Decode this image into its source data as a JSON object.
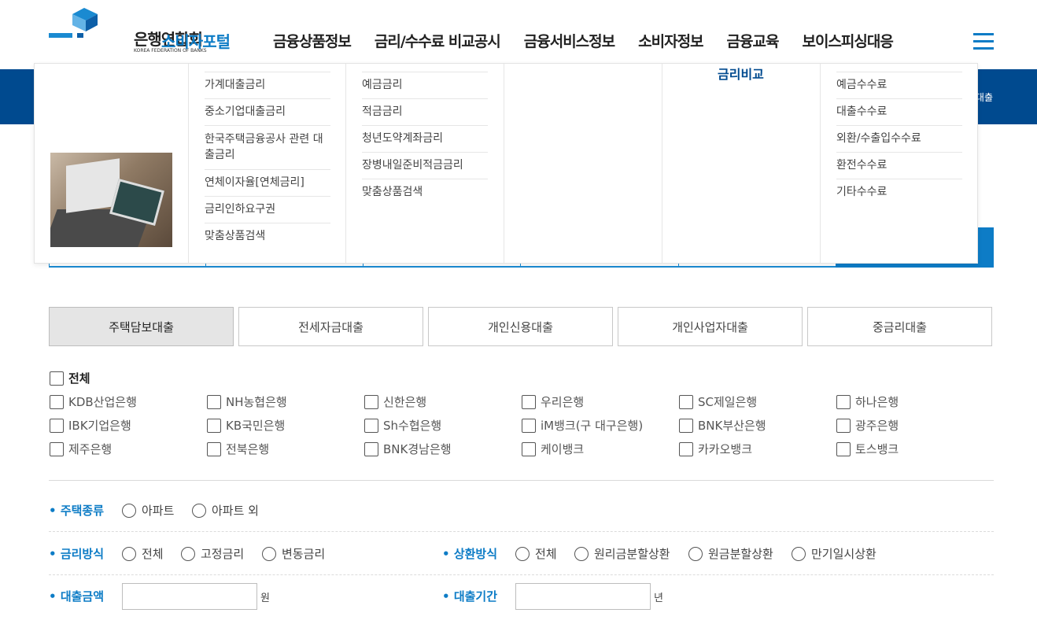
{
  "header": {
    "logo_text": "은행연합회",
    "logo_sub": "KOREA FEDERATION OF BANKS",
    "portal": "소비자포털",
    "nav": [
      "금융상품정보",
      "금리/수수료 비교공시",
      "금융서비스정보",
      "소비자정보",
      "금융교육",
      "보이스피싱대응"
    ]
  },
  "blue_band_text": "대출",
  "mega_menu": {
    "col1": [
      "가계대출금리",
      "중소기업대출금리",
      "한국주택금융공사 관련 대출금리",
      "연체이자율[연체금리]",
      "금리인하요구권",
      "맞춤상품검색"
    ],
    "col2": [
      "예금금리",
      "적금금리",
      "청년도약계좌금리",
      "장병내일준비적금금리",
      "맞춤상품검색"
    ],
    "col4_title": "금리비교",
    "col5": [
      "예금수수료",
      "대출수수료",
      "외환/수출입수수료",
      "환전수수료",
      "기타수수료"
    ]
  },
  "loan_tabs": [
    "주택담보대출",
    "전세자금대출",
    "개인신용대출",
    "개인사업자대출",
    "중금리대출"
  ],
  "banks": {
    "all_label": "전체",
    "rows": [
      [
        "KDB산업은행",
        "NH농협은행",
        "신한은행",
        "우리은행",
        "SC제일은행",
        "하나은행"
      ],
      [
        "IBK기업은행",
        "KB국민은행",
        "Sh수협은행",
        "iM뱅크(구 대구은행)",
        "BNK부산은행",
        "광주은행"
      ],
      [
        "제주은행",
        "전북은행",
        "BNK경남은행",
        "케이뱅크",
        "카카오뱅크",
        "토스뱅크"
      ]
    ]
  },
  "filters": {
    "house_type": {
      "label": "주택종류",
      "options": [
        "아파트",
        "아파트 외"
      ]
    },
    "rate_type": {
      "label": "금리방식",
      "options": [
        "전체",
        "고정금리",
        "변동금리"
      ]
    },
    "repay_type": {
      "label": "상환방식",
      "options": [
        "전체",
        "원리금분할상환",
        "원금분할상환",
        "만기일시상환"
      ]
    },
    "loan_amount": {
      "label": "대출금액",
      "unit": "원",
      "value": ""
    },
    "loan_period": {
      "label": "대출기간",
      "unit": "년",
      "value": ""
    }
  },
  "colors": {
    "brand_blue": "#0d7cc6",
    "navy": "#004a8f"
  }
}
